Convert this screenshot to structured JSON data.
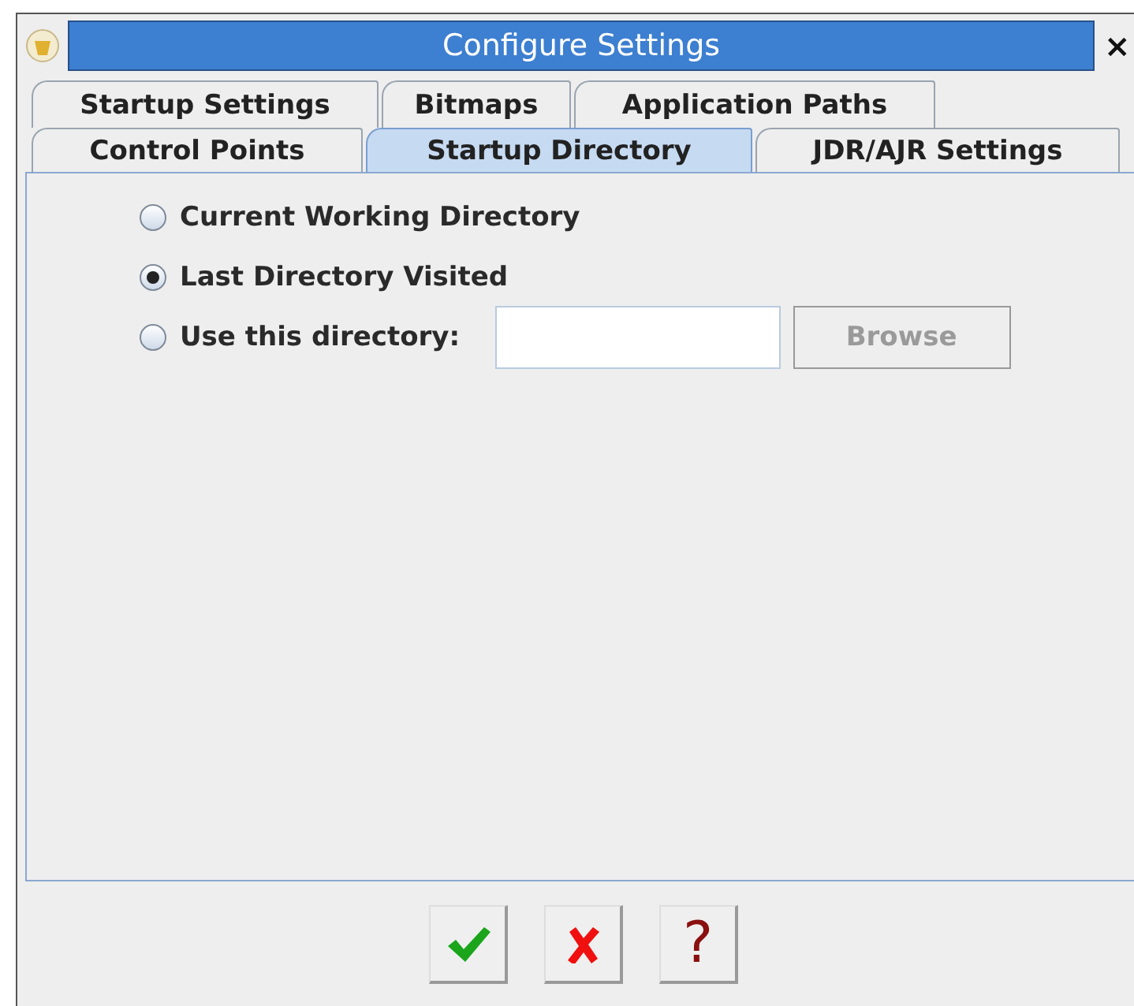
{
  "window": {
    "title": "Configure Settings",
    "close": "×"
  },
  "tab_rows": [
    {
      "tabs": [
        {
          "label": "Startup Settings",
          "selected": false
        },
        {
          "label": "Bitmaps",
          "selected": false
        },
        {
          "label": "Application Paths",
          "selected": false
        }
      ]
    },
    {
      "tabs": [
        {
          "label": "Control Points",
          "selected": false
        },
        {
          "label": "Startup Directory",
          "selected": true
        },
        {
          "label": "JDR/AJR Settings",
          "selected": false
        }
      ]
    }
  ],
  "options": [
    {
      "label": "Current Working Directory",
      "selected": false
    },
    {
      "label": "Last Directory Visited",
      "selected": true
    },
    {
      "label": "Use this directory:",
      "selected": false,
      "field": {
        "kind": "text"
      },
      "button": {
        "label": "Browse",
        "disabled": true
      }
    }
  ],
  "buttons": [
    {
      "kind": "ok"
    },
    {
      "kind": "cancel"
    },
    {
      "kind": "help",
      "label": "?"
    }
  ]
}
